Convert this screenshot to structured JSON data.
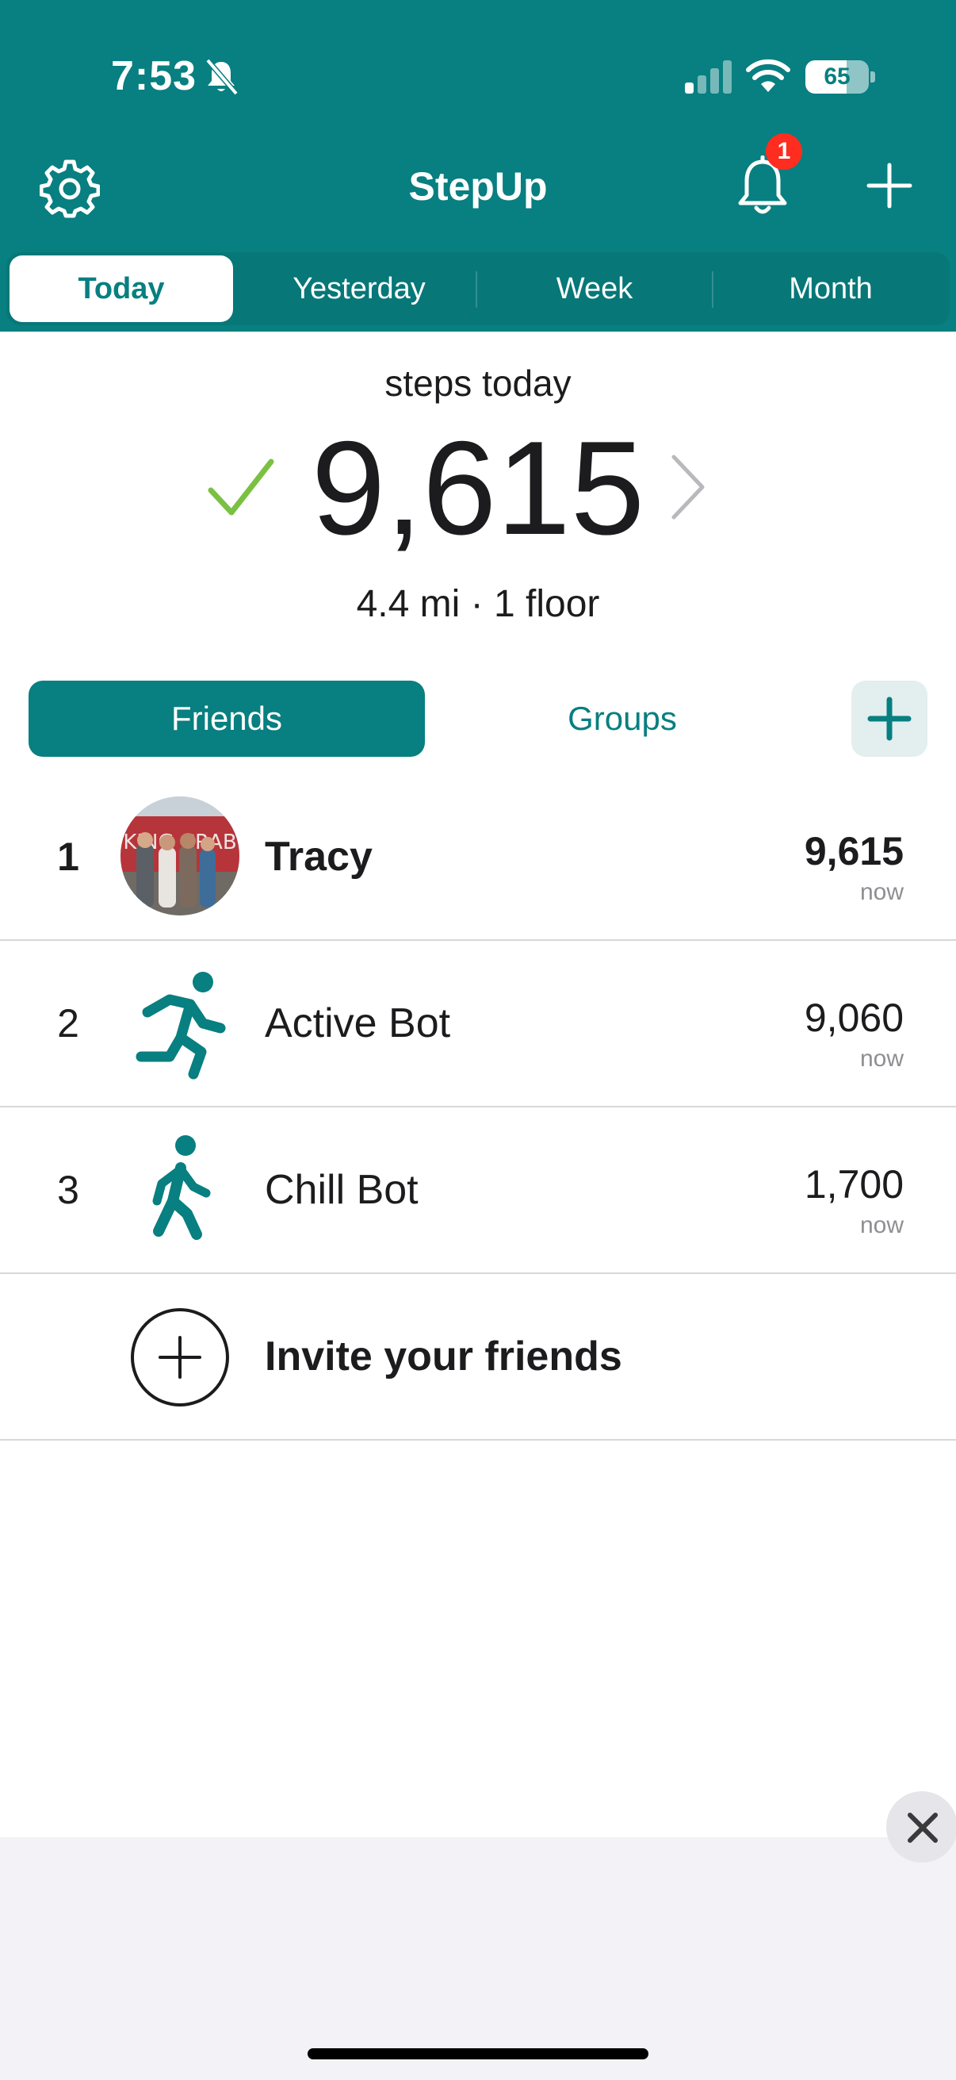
{
  "status_bar": {
    "time": "7:53",
    "battery": "65",
    "battery_level": 0.65
  },
  "header": {
    "title": "StepUp",
    "notification_count": "1",
    "settings_icon": "gear-icon",
    "notifications_icon": "bell-icon",
    "add_icon": "plus-icon"
  },
  "tabs": [
    {
      "label": "Today",
      "active": true
    },
    {
      "label": "Yesterday",
      "active": false
    },
    {
      "label": "Week",
      "active": false
    },
    {
      "label": "Month",
      "active": false
    }
  ],
  "summary": {
    "label": "steps today",
    "steps": "9,615",
    "goal_met_icon": "checkmark-icon",
    "details": "4.4 mi · 1 floor"
  },
  "segment": {
    "friends": "Friends",
    "groups": "Groups",
    "active": "Friends"
  },
  "leaderboard": [
    {
      "rank": "1",
      "name": "Tracy",
      "steps": "9,615",
      "time": "now",
      "avatar": "photo",
      "highlight": true
    },
    {
      "rank": "2",
      "name": "Active Bot",
      "steps": "9,060",
      "time": "now",
      "avatar": "running-person-icon",
      "highlight": false
    },
    {
      "rank": "3",
      "name": "Chill Bot",
      "steps": "1,700",
      "time": "now",
      "avatar": "walking-person-icon",
      "highlight": false
    }
  ],
  "invite": {
    "label": "Invite your friends"
  },
  "colors": {
    "brand": "#087f80",
    "check": "#7ac143",
    "badge": "#ff2d20"
  }
}
